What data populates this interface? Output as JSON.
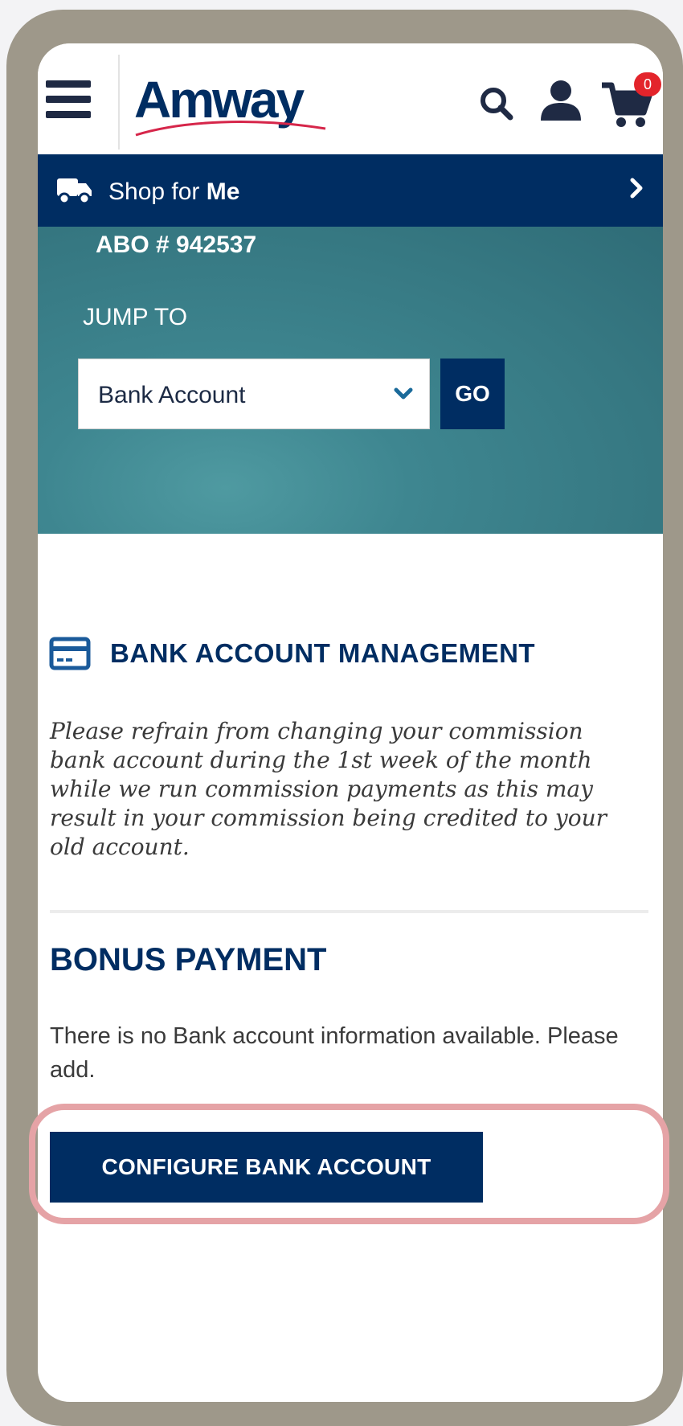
{
  "header": {
    "logo_text": "Amway",
    "cart_count": "0",
    "icons": [
      "menu-icon",
      "search-icon",
      "user-icon",
      "cart-icon"
    ]
  },
  "shop_bar": {
    "prefix": "Shop for ",
    "target": "Me"
  },
  "hero": {
    "abo": "ABO # 942537",
    "jump_to_label": "JUMP TO",
    "selected_option": "Bank Account",
    "go_label": "GO"
  },
  "bank_section": {
    "title": "BANK ACCOUNT MANAGEMENT",
    "notice": "Please refrain from changing your commission bank account during the 1st week of the month while we run commission payments as this may result in your commission being credited to your old account."
  },
  "bonus_section": {
    "title": "BONUS PAYMENT",
    "message": "There is no Bank account information available. Please add.",
    "button_label": "CONFIGURE BANK ACCOUNT"
  },
  "colors": {
    "brand_navy": "#002d62",
    "hero_teal": "#3e8690",
    "badge_red": "#e3242b",
    "highlight": "#e5a3a6",
    "frame": "#9e988a"
  }
}
